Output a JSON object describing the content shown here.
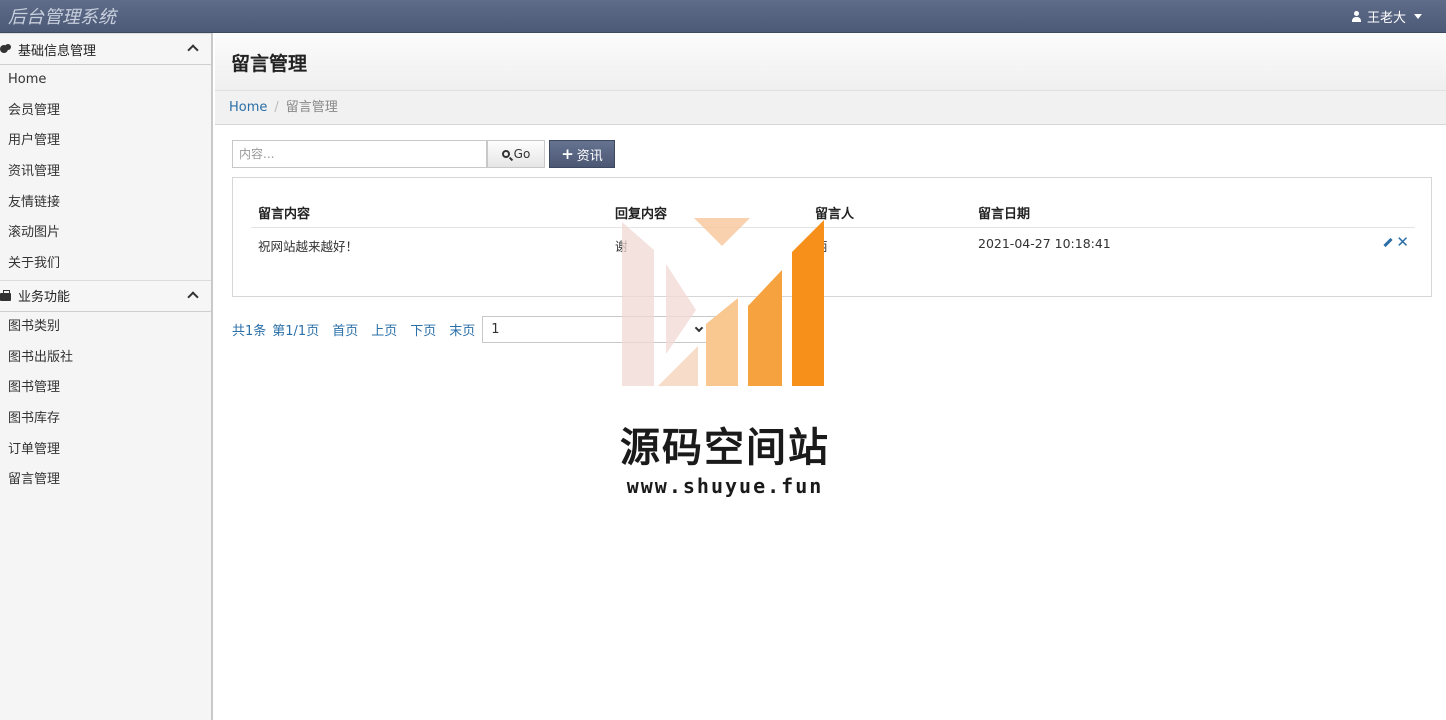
{
  "app": {
    "brand": "后台管理系统",
    "user_name": "王老大"
  },
  "sidebar": {
    "groups": [
      {
        "title": "基础信息管理",
        "items": [
          "Home",
          "会员管理",
          "用户管理",
          "资讯管理",
          "友情链接",
          "滚动图片",
          "关于我们"
        ]
      },
      {
        "title": "业务功能",
        "items": [
          "图书类别",
          "图书出版社",
          "图书管理",
          "图书库存",
          "订单管理",
          "留言管理"
        ]
      }
    ]
  },
  "header": {
    "title": "留言管理"
  },
  "breadcrumb": {
    "home": "Home",
    "sep": "/",
    "current": "留言管理"
  },
  "toolbar": {
    "search_placeholder": "内容...",
    "go_label": "Go",
    "add_label": "资讯"
  },
  "table": {
    "columns": [
      "留言内容",
      "回复内容",
      "留言人",
      "留言日期"
    ],
    "rows": [
      {
        "content": "祝网站越来越好！",
        "reply": "谢",
        "author": "丽",
        "date": "2021-04-27 10:18:41"
      }
    ]
  },
  "pager": {
    "total": "共1条",
    "page_info": "第1/1页",
    "first": "首页",
    "prev": "上页",
    "next": "下页",
    "last": "末页",
    "selected_page": "1"
  },
  "watermark": {
    "title": "源码空间站",
    "url": "www.shuyue.fun"
  },
  "colors": {
    "navbar": "#56637f",
    "link": "#2a6fa8",
    "accent_orange": "#f7941d"
  }
}
